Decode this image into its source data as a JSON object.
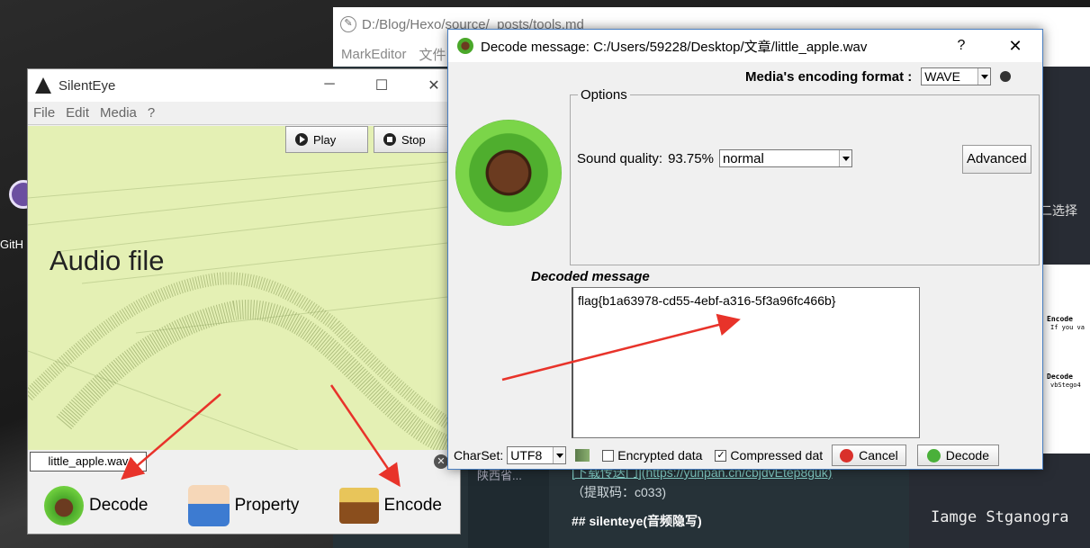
{
  "desktop": {
    "icon_label": "GitH"
  },
  "editor": {
    "title": "D:/Blog/Hexo/source/_posts/tools.md",
    "menu": [
      "MarkEditor",
      "文件"
    ],
    "sidebar_item": "陕西省...",
    "lines": {
      "download": "[下载传送门](https://yunpan.cn/cbjdvEtep8guk)",
      "code": "（提取码：c033)",
      "heading": "## silenteye(音频隐写)"
    },
    "right_text": "二选择 ",
    "right_image": {
      "encode": "Encode",
      "encode_sub": "If you va",
      "decode": "Decode",
      "decode_sub": "vbStego4"
    },
    "mono_text": "Iamge Stganogra"
  },
  "silenteye": {
    "title": "SilentEye",
    "menu": [
      "File",
      "Edit",
      "Media",
      "?"
    ],
    "play_label": "Play",
    "stop_label": "Stop",
    "canvas_label": "Audio file",
    "filename": "little_apple.wav",
    "actions": {
      "decode": "Decode",
      "property": "Property",
      "encode": "Encode"
    }
  },
  "decode_dialog": {
    "title": "Decode message: C:/Users/59228/Desktop/文章/little_apple.wav",
    "help": "?",
    "format_label": "Media's encoding format :",
    "format_value": "WAVE",
    "options_legend": "Options",
    "sound_quality_label": "Sound quality:",
    "sound_quality_pct": "93.75%",
    "sound_quality_value": "normal",
    "advanced_label": "Advanced",
    "decoded_title": "Decoded message",
    "decoded_text": "flag{b1a63978-cd55-4ebf-a316-5f3a96fc466b}",
    "charset_label": "CharSet:",
    "charset_value": "UTF8",
    "encrypted_label": "Encrypted data",
    "encrypted_checked": false,
    "compressed_label": "Compressed dat",
    "compressed_checked": true,
    "cancel_label": "Cancel",
    "decode_label": "Decode"
  },
  "colors": {
    "annotation_arrow": "#e8332a",
    "waveform_bg": "#e4f0b4",
    "dialog_border": "#4a7fc1"
  }
}
